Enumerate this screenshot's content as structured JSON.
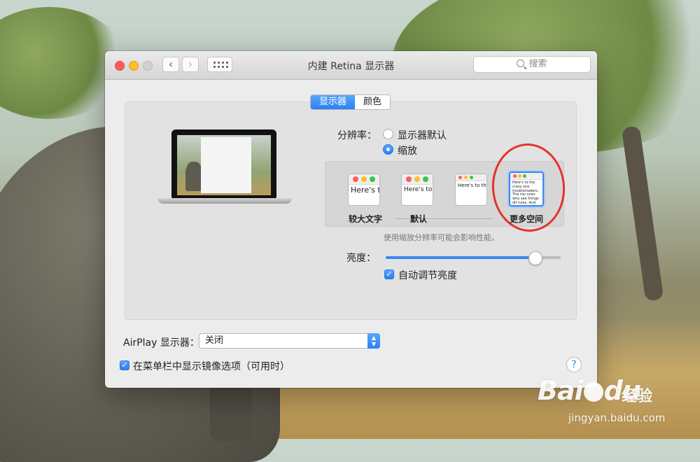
{
  "window": {
    "title": "内建 Retina 显示器",
    "search_placeholder": "搜索",
    "nav_back": "‹",
    "nav_forward": "›"
  },
  "tabs": [
    {
      "label": "显示器",
      "active": true
    },
    {
      "label": "颜色",
      "active": false
    }
  ],
  "resolution": {
    "label": "分辨率：",
    "options": [
      {
        "label": "显示器默认",
        "selected": false
      },
      {
        "label": "缩放",
        "selected": true
      }
    ]
  },
  "scaled_options": [
    {
      "caption": "较大文字",
      "preview": "Here's to troublem",
      "selected": false
    },
    {
      "caption": "默认",
      "preview": "Here's to t troublemak ones who s",
      "selected": false
    },
    {
      "caption": "",
      "preview": "Here's to the cr troublemakers. T ones who see thi rules. And they",
      "selected": false
    },
    {
      "caption": "更多空间",
      "preview": "Here's to the crazy one troublemakers. The rou ones who see things dif rules. And they have n can quote them, disagre them. About the only thi Because they change thi",
      "selected": true
    }
  ],
  "scaling_note": "使用缩放分辨率可能会影响性能。",
  "brightness": {
    "label": "亮度：",
    "level": 0.85
  },
  "auto_brightness": {
    "label": "自动调节亮度",
    "checked": true
  },
  "airplay": {
    "label": "AirPlay 显示器：",
    "value": "关闭"
  },
  "mirroring": {
    "label": "在菜单栏中显示镜像选项（可用时）",
    "checked": true
  },
  "help": "?",
  "watermark": {
    "brand": "Bai",
    "brand2": "du",
    "product": "经验",
    "url": "jingyan.baidu.com"
  },
  "colors": {
    "accent": "#3b86f0",
    "annotation": "#e5332a",
    "traffic_red": "#fc5f57",
    "traffic_yellow": "#fdbc2e",
    "traffic_green": "#34c84a"
  }
}
